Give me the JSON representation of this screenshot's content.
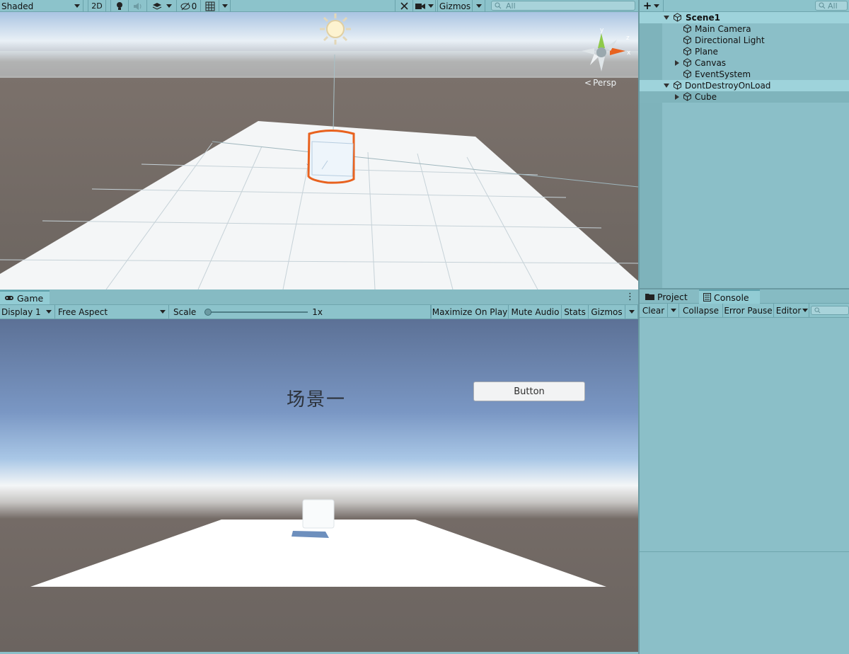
{
  "scene_toolbar": {
    "draw_mode": "Shaded",
    "mode_2d": "2D",
    "hidden_count": "0",
    "gizmos": "Gizmos",
    "search_placeholder": "All"
  },
  "scene_view": {
    "projection": "Persp",
    "gizmo_axis_y": "y",
    "gizmo_axis_x": "x",
    "gizmo_axis_z": "z"
  },
  "hierarchy": {
    "search_placeholder": "All",
    "scenes": [
      {
        "name": "Scene1",
        "items": [
          "Main Camera",
          "Directional Light",
          "Plane",
          "Canvas",
          "EventSystem"
        ]
      },
      {
        "name": "DontDestroyOnLoad",
        "items": [
          "Cube"
        ]
      }
    ]
  },
  "game_tab": {
    "label": "Game"
  },
  "game_toolbar": {
    "display": "Display 1",
    "aspect": "Free Aspect",
    "scale_label": "Scale",
    "scale_value": "1x",
    "scale_fraction": 0,
    "maximize": "Maximize On Play",
    "mute": "Mute Audio",
    "stats": "Stats",
    "gizmos": "Gizmos"
  },
  "game_view": {
    "title_text": "场景一",
    "button_label": "Button"
  },
  "bottom_tabs": {
    "project": "Project",
    "console": "Console"
  },
  "console_toolbar": {
    "clear": "Clear",
    "collapse": "Collapse",
    "error_pause": "Error Pause",
    "editor": "Editor"
  },
  "colors": {
    "selection_outline": "#e8621f",
    "panel": "#8bbfc8",
    "highlight_row": "#9ed3db"
  }
}
